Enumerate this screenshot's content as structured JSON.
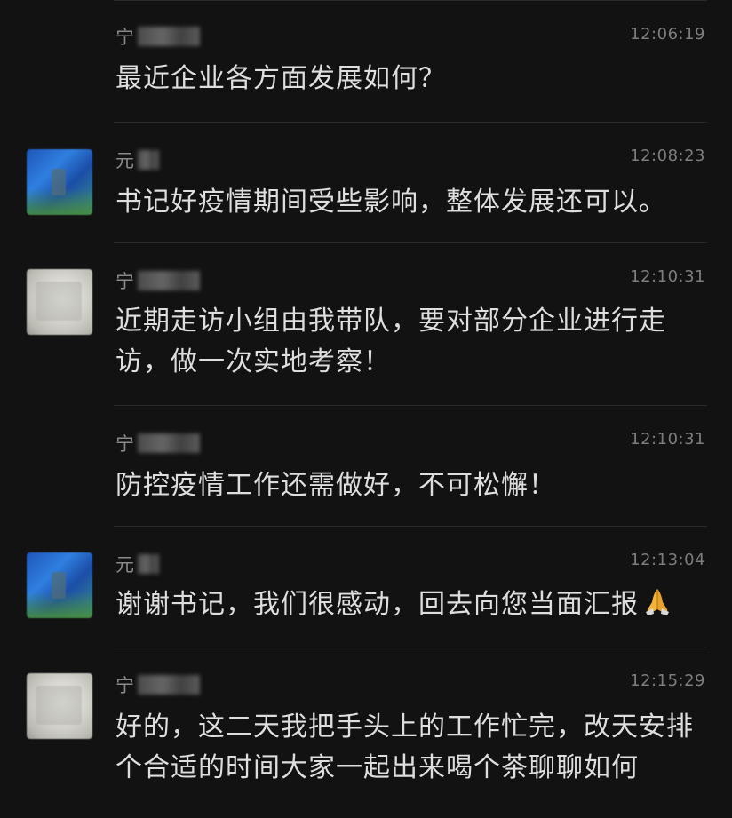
{
  "messages": [
    {
      "sender": "宁",
      "time": "12:06:19",
      "text": "最近企业各方面发展如何？",
      "avatar": "none"
    },
    {
      "sender": "元",
      "time": "12:08:23",
      "text": "书记好疫情期间受些影响，整体发展还可以。",
      "avatar": "blue-landscape"
    },
    {
      "sender": "宁",
      "time": "12:10:31",
      "text": "近期走访小组由我带队，要对部分企业进行走访，做一次实地考察！",
      "avatar": "gray"
    },
    {
      "sender": "宁",
      "time": "12:10:31",
      "text": "防控疫情工作还需做好，不可松懈！",
      "avatar": "none"
    },
    {
      "sender": "元",
      "time": "12:13:04",
      "text": "谢谢书记，我们很感动，回去向您当面汇报",
      "emoji": "folded-hands-icon",
      "avatar": "blue-landscape"
    },
    {
      "sender": "宁",
      "time": "12:15:29",
      "text": "好的，这二天我把手头上的工作忙完，改天安排个合适的时间大家一起出来喝个茶聊聊如何",
      "avatar": "gray"
    }
  ],
  "colors": {
    "background": "#121212",
    "text": "#dedede",
    "meta": "#8a8a8a"
  }
}
